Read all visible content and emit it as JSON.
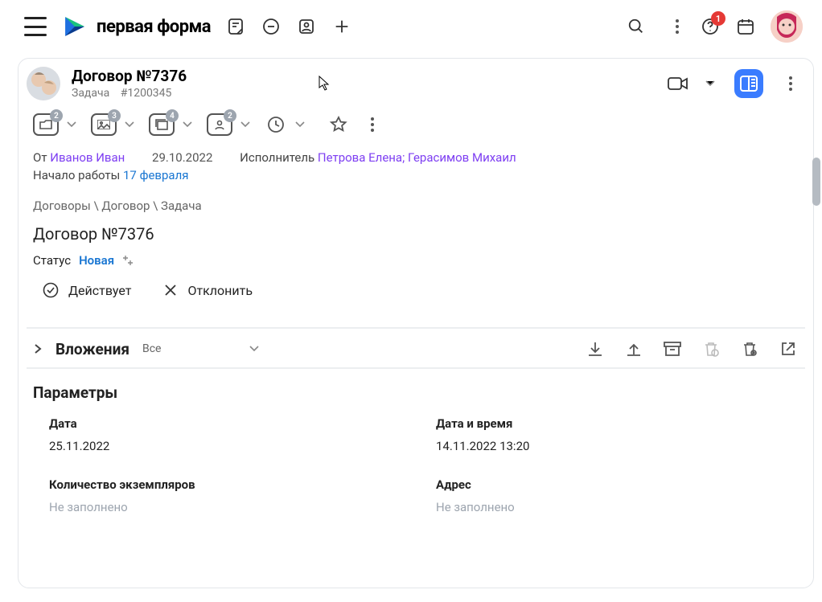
{
  "topbar": {
    "brand": "первая форма",
    "notification_count": "1"
  },
  "card": {
    "title": "Договор №7376",
    "subtitle_type": "Задача",
    "subtitle_id": "#1200345",
    "tool_counts": {
      "a": "2",
      "b": "3",
      "c": "4",
      "d": "2"
    }
  },
  "meta": {
    "from_label": "От",
    "from_value": "Иванов Иван",
    "date": "29.10.2022",
    "exec_label": "Исполнитель",
    "exec_value": "Петрова Елена; Герасимов Михаил",
    "start_label": "Начало работы",
    "start_value": "17 февраля"
  },
  "breadcrumb": "Договоры \\ Договор \\ Задача",
  "doc_title": "Договор №7376",
  "status": {
    "label": "Статус",
    "value": "Новая"
  },
  "actions": {
    "approve": "Действует",
    "reject": "Отклонить"
  },
  "attachments": {
    "title": "Вложения",
    "filter": "Все"
  },
  "params_title": "Параметры",
  "params": {
    "date_label": "Дата",
    "date_value": "25.11.2022",
    "datetime_label": "Дата и время",
    "datetime_value": "14.11.2022 13:20",
    "copies_label": "Количество экземпляров",
    "copies_value": "Не заполнено",
    "addr_label": "Адрес",
    "addr_value": "Не заполнено"
  }
}
